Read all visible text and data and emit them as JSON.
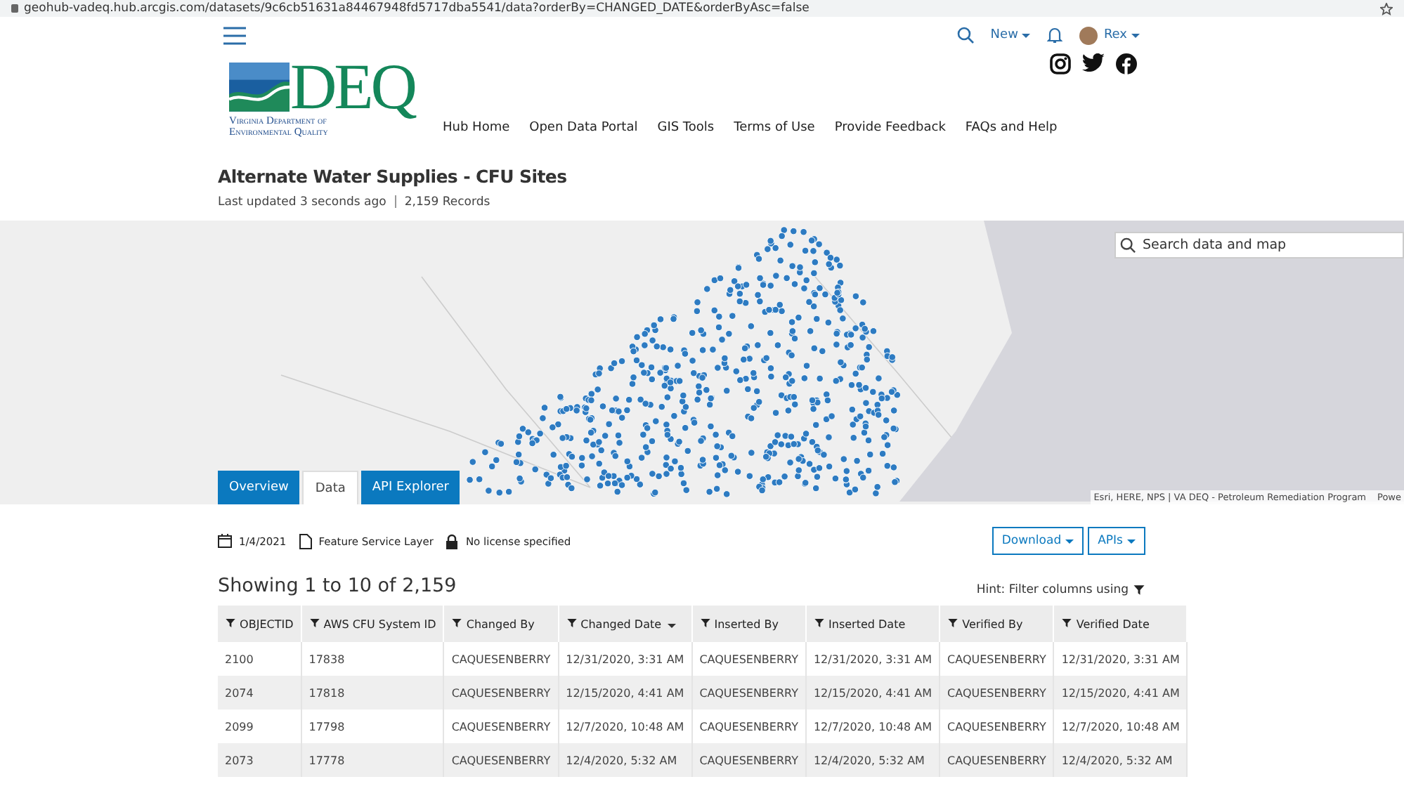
{
  "browser": {
    "url": "geohub-vadeq.hub.arcgis.com/datasets/9c6cb51631a84467948fd5717dba5541/data?orderBy=CHANGED_DATE&orderByAsc=false"
  },
  "header": {
    "new_label": "New",
    "user": "Rex",
    "nav": [
      "Hub Home",
      "Open Data Portal",
      "GIS Tools",
      "Terms of Use",
      "Provide Feedback",
      "FAQs and Help"
    ]
  },
  "logo": {
    "letters": "DEQ",
    "line_1": "Virginia Department of",
    "line_2": "Environmental Quality"
  },
  "dataset": {
    "title": "Alternate Water Supplies - CFU Sites",
    "updated": "Last updated 3 seconds ago",
    "records": "2,159 Records"
  },
  "map": {
    "search": {
      "placeholder": "Search data and map"
    },
    "attribution": "Esri, HERE, NPS | VA DEQ - Petroleum Remediation Program",
    "powered": "Powe"
  },
  "tabs": [
    {
      "label": "Overview",
      "selected": false
    },
    {
      "label": "Data",
      "selected": true
    },
    {
      "label": "API Explorer",
      "selected": false
    }
  ],
  "meta": {
    "date": "1/4/2021",
    "type": "Feature Service Layer",
    "license": "No license specified"
  },
  "buttons": [
    "Download",
    "APIs"
  ],
  "showing": "Showing 1 to 10 of 2,159",
  "hint": "Hint: Filter columns using",
  "table": {
    "columns": [
      {
        "label": "OBJECTID",
        "sorted": false
      },
      {
        "label": "AWS CFU System ID",
        "sorted": false
      },
      {
        "label": "Changed By",
        "sorted": false
      },
      {
        "label": "Changed Date",
        "sorted": true
      },
      {
        "label": "Inserted By",
        "sorted": false
      },
      {
        "label": "Inserted Date",
        "sorted": false
      },
      {
        "label": "Verified By",
        "sorted": false
      },
      {
        "label": "Verified Date",
        "sorted": false
      }
    ],
    "rows": [
      [
        "2100",
        "17838",
        "CAQUESENBERRY",
        "12/31/2020, 3:31 AM",
        "CAQUESENBERRY",
        "12/31/2020, 3:31 AM",
        "CAQUESENBERRY",
        "12/31/2020, 3:31 AM"
      ],
      [
        "2074",
        "17818",
        "CAQUESENBERRY",
        "12/15/2020, 4:41 AM",
        "CAQUESENBERRY",
        "12/15/2020, 4:41 AM",
        "CAQUESENBERRY",
        "12/15/2020, 4:41 AM"
      ],
      [
        "2099",
        "17798",
        "CAQUESENBERRY",
        "12/7/2020, 10:48 AM",
        "CAQUESENBERRY",
        "12/7/2020, 10:48 AM",
        "CAQUESENBERRY",
        "12/7/2020, 10:48 AM"
      ],
      [
        "2073",
        "17778",
        "CAQUESENBERRY",
        "12/4/2020, 5:32 AM",
        "CAQUESENBERRY",
        "12/4/2020, 5:32 AM",
        "CAQUESENBERRY",
        "12/4/2020, 5:32 AM"
      ]
    ]
  }
}
